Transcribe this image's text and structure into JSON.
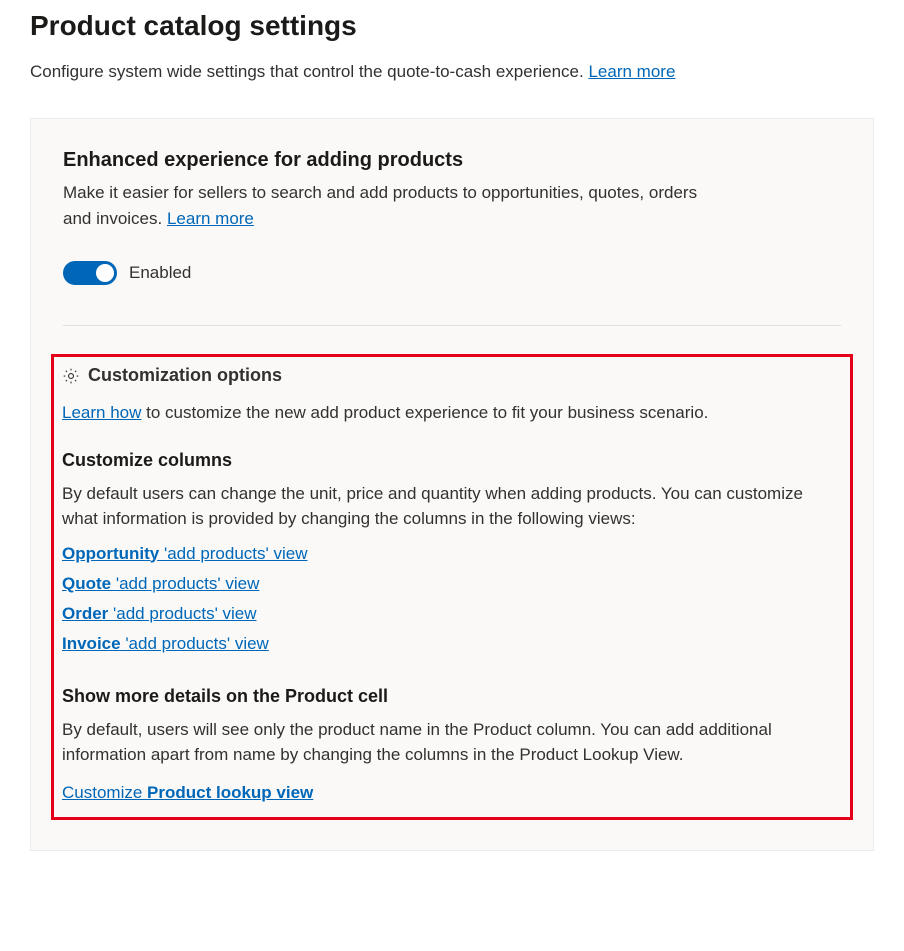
{
  "page": {
    "title": "Product catalog settings",
    "subtitle_prefix": "Configure system wide settings that control the quote-to-cash experience. ",
    "subtitle_link": "Learn more"
  },
  "card": {
    "heading": "Enhanced experience for adding products",
    "desc_prefix": "Make it easier for sellers to search and add products to opportunities, quotes, orders and invoices. ",
    "desc_link": "Learn more",
    "toggle_label": "Enabled"
  },
  "customization": {
    "heading": "Customization options",
    "intro_link": "Learn how",
    "intro_rest": " to customize the new add product experience to fit your business scenario.",
    "columns_heading": "Customize columns",
    "columns_desc": "By default users can change the unit, price and quantity when adding products. You can customize what information is provided by changing the columns in the following views:",
    "views": [
      {
        "entity": "Opportunity ",
        "rest": "'add products' view"
      },
      {
        "entity": "Quote ",
        "rest": "'add products' view"
      },
      {
        "entity": "Order ",
        "rest": "'add products' view"
      },
      {
        "entity": "Invoice ",
        "rest": "'add products' view"
      }
    ],
    "details_heading": "Show more details on the Product cell",
    "details_desc": "By default, users will see only the product name in the Product column. You can add additional information apart from name by changing the columns in the Product Lookup View.",
    "lookup_link_prefix": "Customize ",
    "lookup_link_bold": "Product lookup view"
  }
}
